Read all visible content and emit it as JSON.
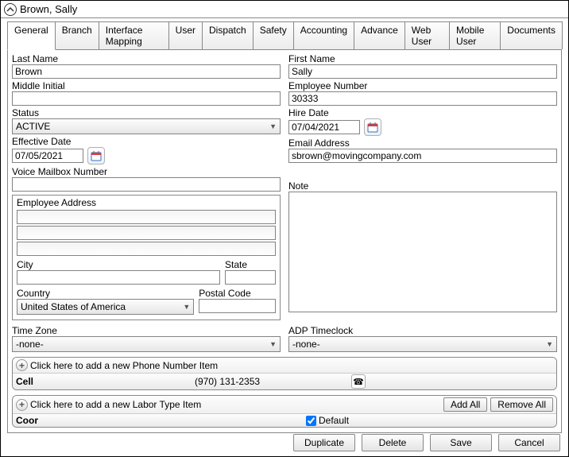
{
  "title": "Brown, Sally",
  "tabs": [
    "General",
    "Branch",
    "Interface Mapping",
    "User",
    "Dispatch",
    "Safety",
    "Accounting",
    "Advance",
    "Web User",
    "Mobile User",
    "Documents"
  ],
  "labels": {
    "last_name": "Last Name",
    "first_name": "First Name",
    "middle_initial": "Middle Initial",
    "employee_number": "Employee Number",
    "status": "Status",
    "hire_date": "Hire Date",
    "effective_date": "Effective Date",
    "email": "Email Address",
    "voice_mailbox": "Voice Mailbox Number",
    "note": "Note",
    "emp_addr": "Employee Address",
    "city": "City",
    "state": "State",
    "country": "Country",
    "postal": "Postal Code",
    "timezone": "Time Zone",
    "adp": "ADP Timeclock",
    "add_phone": "Click here to add a new Phone Number Item",
    "add_labor": "Click here to add a new Labor Type Item",
    "add_all": "Add All",
    "remove_all": "Remove All",
    "default": "Default"
  },
  "fields": {
    "last_name": "Brown",
    "first_name": "Sally",
    "middle_initial": "",
    "employee_number": "30333",
    "status": "ACTIVE",
    "hire_date": "07/04/2021",
    "effective_date": "07/05/2021",
    "email": "sbrown@movingcompany.com",
    "voice_mailbox": "",
    "note": "",
    "addr1": "",
    "addr2": "",
    "addr3": "",
    "city": "",
    "state": "",
    "country": "United States of America",
    "postal": "",
    "timezone": "-none-",
    "adp": "-none-"
  },
  "phone": {
    "type": "Cell",
    "number": "(970) 131-2353"
  },
  "labor": {
    "type": "Coor",
    "default": true
  },
  "buttons": {
    "duplicate": "Duplicate",
    "delete": "Delete",
    "save": "Save",
    "cancel": "Cancel"
  }
}
